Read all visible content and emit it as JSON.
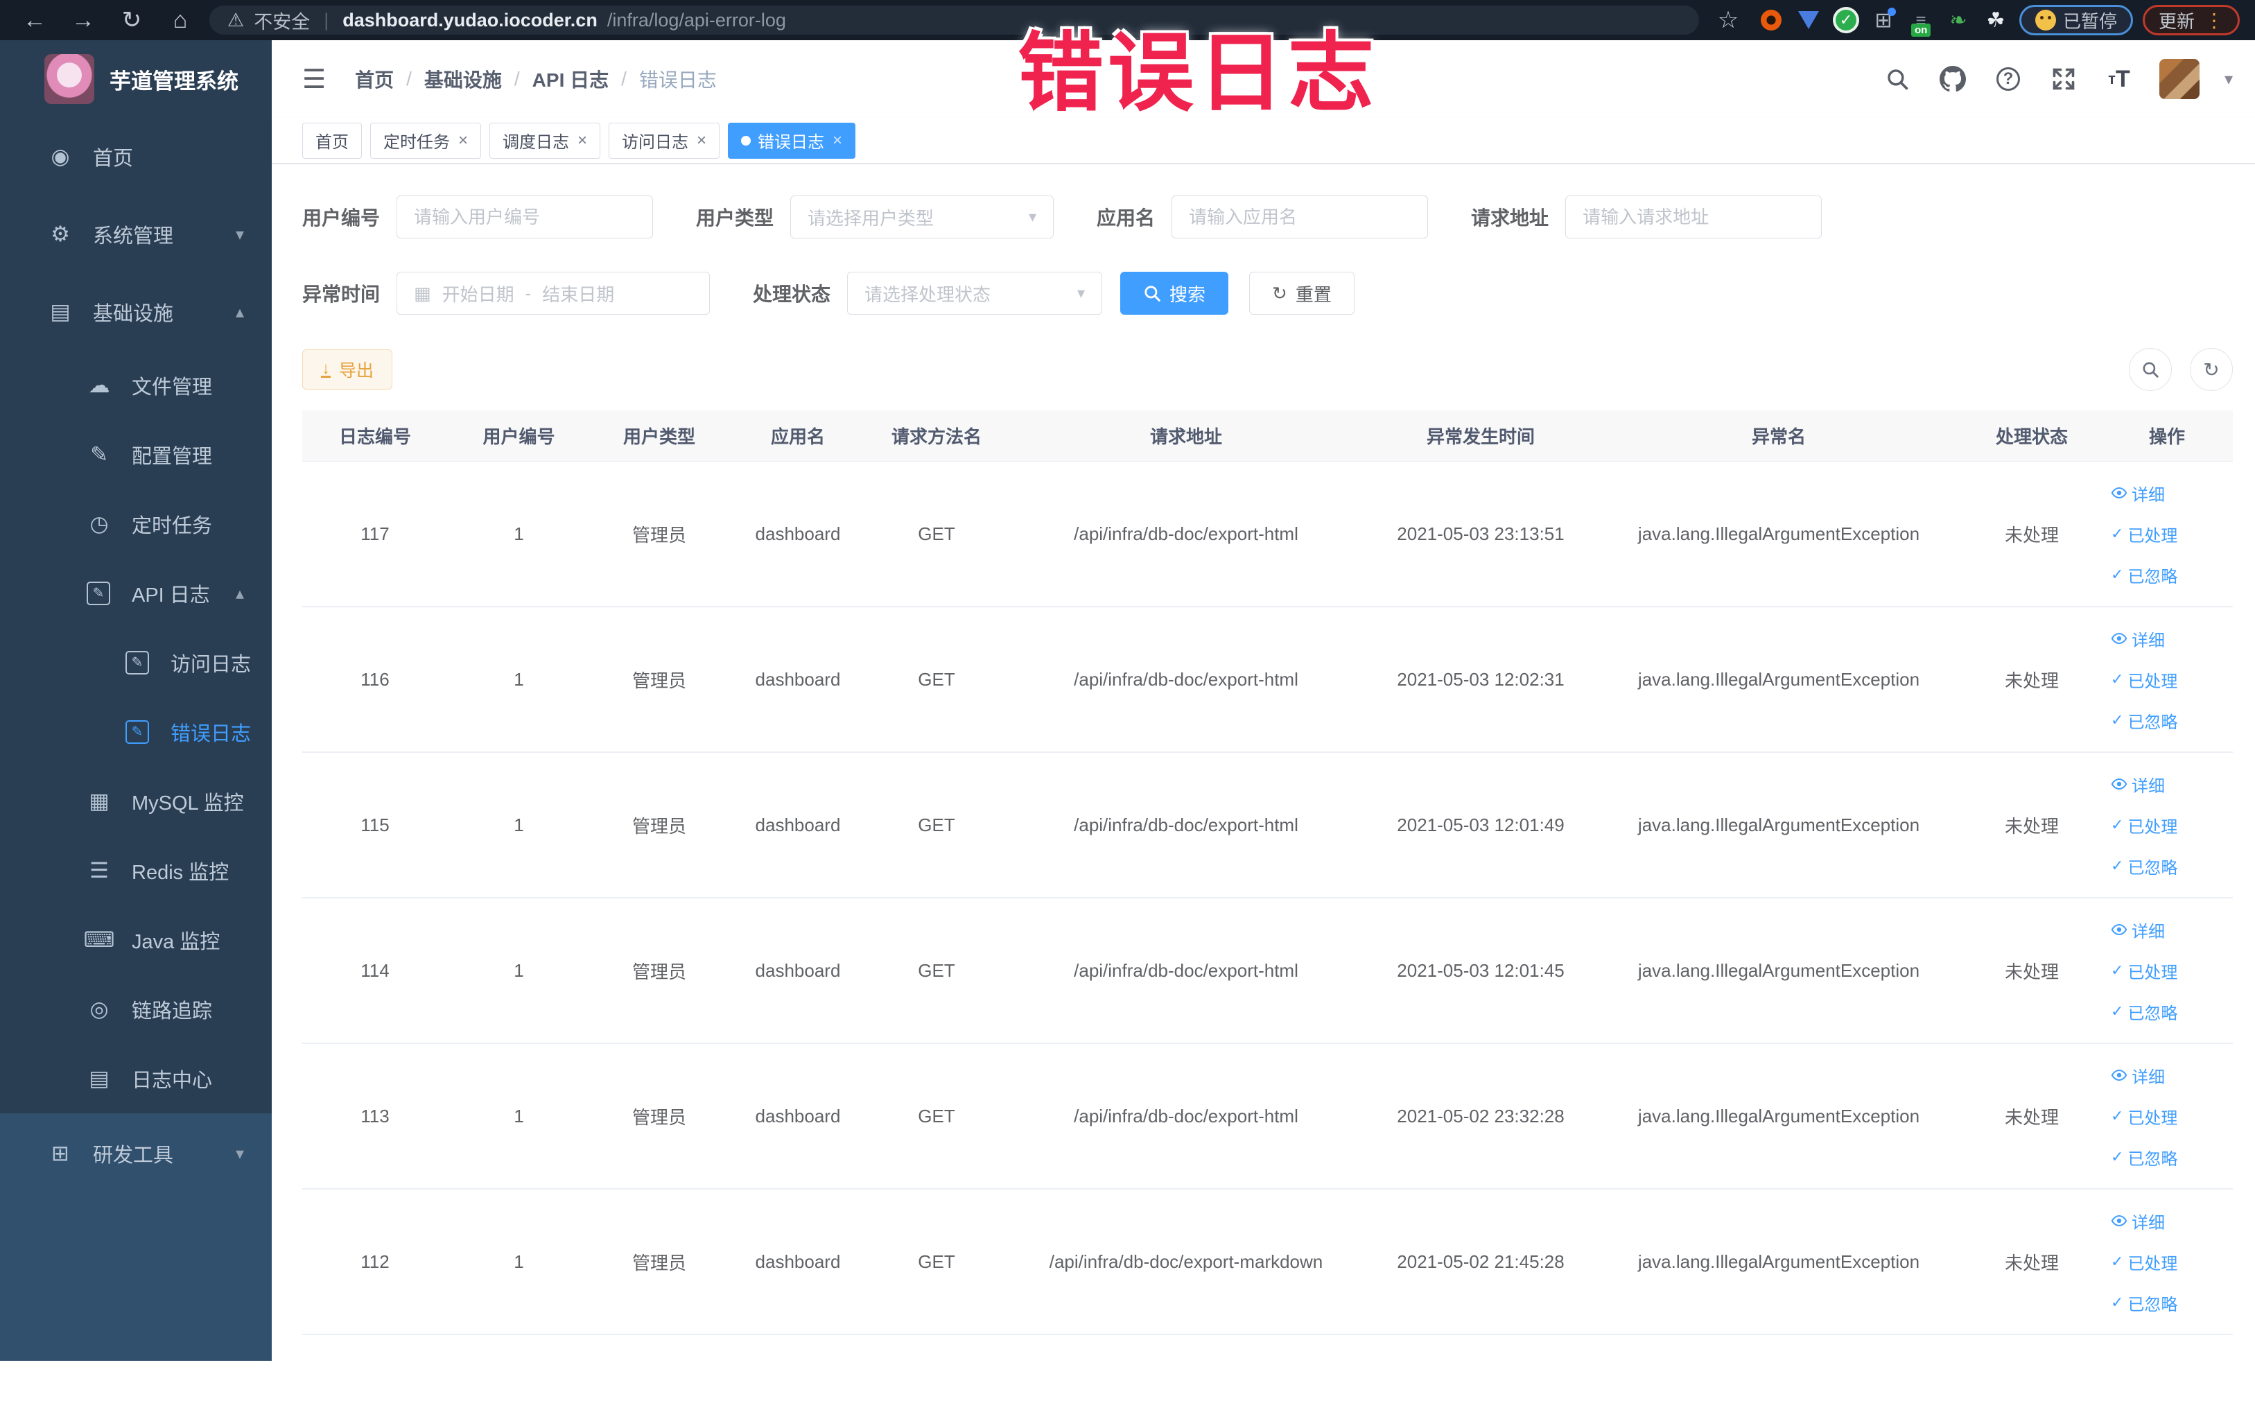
{
  "browser": {
    "security_label": "不安全",
    "url_host": "dashboard.yudao.iocoder.cn",
    "url_path": "/infra/log/api-error-log",
    "paused_label": "已暂停",
    "update_label": "更新"
  },
  "overlay_title": "错误日志",
  "sidebar": {
    "title": "芋道管理系统",
    "menu": [
      {
        "name": "home",
        "label": "首页",
        "icon": "dashboard-icon",
        "level": 1
      },
      {
        "name": "system-management",
        "label": "系统管理",
        "icon": "gear-icon",
        "level": 1,
        "chevron": "down"
      },
      {
        "name": "infrastructure",
        "label": "基础设施",
        "icon": "monitor-icon",
        "level": 1,
        "chevron": "up"
      },
      {
        "name": "file-management",
        "label": "文件管理",
        "icon": "cloud-upload-icon",
        "level": 2
      },
      {
        "name": "config-management",
        "label": "配置管理",
        "icon": "edit-icon",
        "level": 2
      },
      {
        "name": "cron-job",
        "label": "定时任务",
        "icon": "timer-icon",
        "level": 2
      },
      {
        "name": "api-log",
        "label": "API 日志",
        "icon": "log-icon",
        "level": 2,
        "chevron": "up"
      },
      {
        "name": "access-log",
        "label": "访问日志",
        "icon": "log-icon",
        "level": 3
      },
      {
        "name": "error-log",
        "label": "错误日志",
        "icon": "log-icon",
        "level": 3,
        "active": true
      },
      {
        "name": "mysql-monitor",
        "label": "MySQL 监控",
        "icon": "mysql-icon",
        "level": 2
      },
      {
        "name": "redis-monitor",
        "label": "Redis 监控",
        "icon": "redis-icon",
        "level": 2
      },
      {
        "name": "java-monitor",
        "label": "Java 监控",
        "icon": "java-icon",
        "level": 2
      },
      {
        "name": "trace",
        "label": "链路追踪",
        "icon": "trace-icon",
        "level": 2
      },
      {
        "name": "log-center",
        "label": "日志中心",
        "icon": "log-center-icon",
        "level": 2
      },
      {
        "name": "dev-tools",
        "label": "研发工具",
        "icon": "toolbox-icon",
        "level": 1,
        "chevron": "down",
        "section": "dev"
      }
    ]
  },
  "header": {
    "breadcrumb": [
      "首页",
      "基础设施",
      "API 日志",
      "错误日志"
    ]
  },
  "tabs": [
    {
      "name": "home",
      "label": "首页"
    },
    {
      "name": "cron-job",
      "label": "定时任务",
      "closable": true
    },
    {
      "name": "schedule-log",
      "label": "调度日志",
      "closable": true
    },
    {
      "name": "access-log",
      "label": "访问日志",
      "closable": true
    },
    {
      "name": "error-log",
      "label": "错误日志",
      "closable": true,
      "active": true
    }
  ],
  "filters": {
    "user_id": {
      "label": "用户编号",
      "placeholder": "请输入用户编号"
    },
    "user_type": {
      "label": "用户类型",
      "placeholder": "请选择用户类型"
    },
    "app_name": {
      "label": "应用名",
      "placeholder": "请输入应用名"
    },
    "request_url": {
      "label": "请求地址",
      "placeholder": "请输入请求地址"
    },
    "exception_time": {
      "label": "异常时间",
      "start": "开始日期",
      "separator": "-",
      "end": "结束日期"
    },
    "process_status": {
      "label": "处理状态",
      "placeholder": "请选择处理状态"
    },
    "search_label": "搜索",
    "reset_label": "重置"
  },
  "toolbar": {
    "export_label": "导出"
  },
  "table": {
    "columns": [
      "日志编号",
      "用户编号",
      "用户类型",
      "应用名",
      "请求方法名",
      "请求地址",
      "异常发生时间",
      "异常名",
      "处理状态",
      "操作"
    ],
    "actions": [
      {
        "name": "detail-link",
        "icon": "eye-icon",
        "label": "详细"
      },
      {
        "name": "processed-link",
        "icon": "check-icon",
        "label": "已处理"
      },
      {
        "name": "ignored-link",
        "icon": "check-icon",
        "label": "已忽略"
      }
    ],
    "rows": [
      [
        "117",
        "1",
        "管理员",
        "dashboard",
        "GET",
        "/api/infra/db-doc/export-html",
        "2021-05-03 23:13:51",
        "java.lang.IllegalArgumentException",
        "未处理"
      ],
      [
        "116",
        "1",
        "管理员",
        "dashboard",
        "GET",
        "/api/infra/db-doc/export-html",
        "2021-05-03 12:02:31",
        "java.lang.IllegalArgumentException",
        "未处理"
      ],
      [
        "115",
        "1",
        "管理员",
        "dashboard",
        "GET",
        "/api/infra/db-doc/export-html",
        "2021-05-03 12:01:49",
        "java.lang.IllegalArgumentException",
        "未处理"
      ],
      [
        "114",
        "1",
        "管理员",
        "dashboard",
        "GET",
        "/api/infra/db-doc/export-html",
        "2021-05-03 12:01:45",
        "java.lang.IllegalArgumentException",
        "未处理"
      ],
      [
        "113",
        "1",
        "管理员",
        "dashboard",
        "GET",
        "/api/infra/db-doc/export-html",
        "2021-05-02 23:32:28",
        "java.lang.IllegalArgumentException",
        "未处理"
      ],
      [
        "112",
        "1",
        "管理员",
        "dashboard",
        "GET",
        "/api/infra/db-doc/export-markdown",
        "2021-05-02 21:45:28",
        "java.lang.IllegalArgumentException",
        "未处理"
      ]
    ]
  }
}
